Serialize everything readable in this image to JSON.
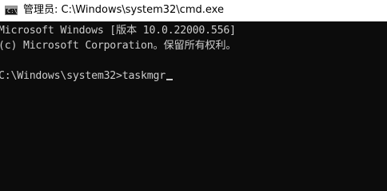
{
  "window": {
    "title": "管理员: C:\\Windows\\system32\\cmd.exe",
    "icon": "cmd-icon"
  },
  "console": {
    "lines": [
      "Microsoft Windows [版本 10.0.22000.556]",
      "(c) Microsoft Corporation。保留所有权利。"
    ],
    "prompt": "C:\\Windows\\system32>",
    "input": "taskmgr"
  },
  "colors": {
    "background": "#0c0c0c",
    "text": "#cccccc",
    "titlebar": "#ffffff"
  }
}
